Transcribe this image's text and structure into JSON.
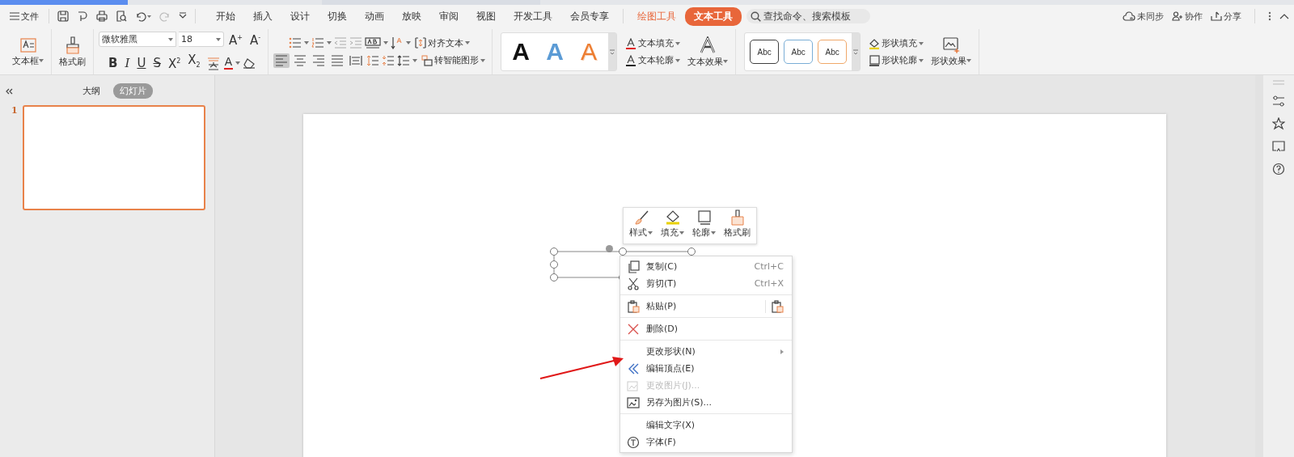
{
  "menu_bar": {
    "file_menu": "文件",
    "tabs": [
      {
        "label": "开始",
        "kind": "main",
        "selected": false
      },
      {
        "label": "插入",
        "kind": "main",
        "selected": false
      },
      {
        "label": "设计",
        "kind": "main",
        "selected": false
      },
      {
        "label": "切换",
        "kind": "main",
        "selected": false
      },
      {
        "label": "动画",
        "kind": "main",
        "selected": false
      },
      {
        "label": "放映",
        "kind": "main",
        "selected": false
      },
      {
        "label": "审阅",
        "kind": "main",
        "selected": false
      },
      {
        "label": "视图",
        "kind": "main",
        "selected": false
      },
      {
        "label": "开发工具",
        "kind": "main",
        "selected": false
      },
      {
        "label": "会员专享",
        "kind": "main",
        "selected": false
      },
      {
        "label": "绘图工具",
        "kind": "contextual",
        "selected": false
      },
      {
        "label": "文本工具",
        "kind": "contextual",
        "selected": true
      }
    ],
    "search": {
      "placeholder": "查找命令、搜索模板"
    },
    "actions": [
      "未同步",
      "协作",
      "分享"
    ]
  },
  "ribbon": {
    "text_box_button": "文本框",
    "format_painter_button": "格式刷",
    "font_name": "微软雅黑",
    "font_size": "18",
    "grow_font": "A$^{+}$",
    "shrink_font": "A$^{-}$",
    "format_buttons": [
      {
        "label": "B",
        "kind": "bold"
      },
      {
        "label": "I",
        "kind": "italic"
      },
      {
        "label": "U",
        "kind": "underline"
      },
      {
        "label": "S",
        "kind": "strike"
      },
      {
        "label": "X$^{2}$",
        "kind": "plain"
      },
      {
        "label": "X$_{2}$",
        "kind": "plain"
      }
    ],
    "font_color_button": "A",
    "alignment_buttons": [
      {
        "selected": true
      },
      {
        "selected": false
      },
      {
        "selected": false
      },
      {
        "selected": false
      },
      {
        "selected": false
      }
    ],
    "align_text_button": "对齐文本",
    "smart_art_button": "转智能图形",
    "text_styles": [
      {
        "label": "A",
        "kind": "solid",
        "color": "#111111"
      },
      {
        "label": "A",
        "kind": "solid",
        "color": "#5b9bd5"
      },
      {
        "label": "A",
        "kind": "outline",
        "color": "#ed7d31"
      }
    ],
    "text_fill_button": "文本填充",
    "text_outline_button": "文本轮廓",
    "text_effects_button": "文本效果",
    "shape_styles": [
      {
        "label": "Abc",
        "color": "#404040"
      },
      {
        "label": "Abc",
        "color": "#7aaed6"
      },
      {
        "label": "Abc",
        "color": "#f0a86a"
      }
    ],
    "shape_fill_button": "形状填充",
    "shape_outline_button": "形状轮廓",
    "shape_effects_button": "形状效果"
  },
  "left_panel": {
    "tabs": [
      {
        "label": "大纲",
        "selected": false
      },
      {
        "label": "幻灯片",
        "selected": true
      }
    ],
    "slides": [
      {
        "number": "1",
        "selected": true
      }
    ]
  },
  "mini_toolbar": [
    {
      "label": "样式",
      "has_menu": true
    },
    {
      "label": "填充",
      "has_menu": true
    },
    {
      "label": "轮廓",
      "has_menu": true
    },
    {
      "label": "格式刷",
      "has_menu": false
    }
  ],
  "context_menu": [
    {
      "kind": "item",
      "label": "复制(C)",
      "shortcut": "Ctrl+C",
      "disabled": false,
      "submenu": false
    },
    {
      "kind": "item",
      "label": "剪切(T)",
      "shortcut": "Ctrl+X",
      "disabled": false,
      "submenu": false
    },
    {
      "kind": "separator"
    },
    {
      "kind": "item",
      "label": "粘贴(P)",
      "disabled": false,
      "submenu": false,
      "paste_option": true
    },
    {
      "kind": "separator"
    },
    {
      "kind": "item",
      "label": "删除(D)",
      "disabled": false,
      "submenu": false
    },
    {
      "kind": "separator"
    },
    {
      "kind": "item",
      "label": "更改形状(N)",
      "disabled": false,
      "submenu": true
    },
    {
      "kind": "item",
      "label": "编辑顶点(E)",
      "disabled": false,
      "submenu": false
    },
    {
      "kind": "item",
      "label": "更改图片(J)...",
      "disabled": true,
      "submenu": false
    },
    {
      "kind": "item",
      "label": "另存为图片(S)...",
      "disabled": false,
      "submenu": false
    },
    {
      "kind": "separator"
    },
    {
      "kind": "item",
      "label": "编辑文字(X)",
      "disabled": false,
      "submenu": false
    },
    {
      "kind": "item",
      "label": "字体(F)",
      "disabled": false,
      "submenu": false
    }
  ]
}
